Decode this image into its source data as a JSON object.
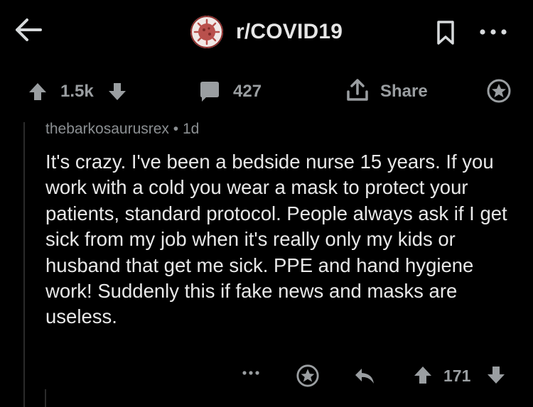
{
  "header": {
    "subreddit": "r/COVID19"
  },
  "post_actions": {
    "score": "1.5k",
    "comments": "427",
    "share_label": "Share"
  },
  "comment": {
    "author": "thebarkosaurusrex",
    "separator": "•",
    "age": "1d",
    "body": "It's crazy. I've been a bedside nurse 15 years. If you work with a cold you wear a mask to protect your patients, standard protocol. People always ask if I get sick from my job when it's really only my kids or husband that get me sick. PPE and hand hygiene work! Suddenly this if fake news and masks are useless.",
    "score": "171"
  },
  "colors": {
    "background": "#000000",
    "text": "#e8e8e8",
    "muted": "#9a9ea1"
  },
  "icons": [
    "back-arrow-icon",
    "subreddit-avatar-icon",
    "bookmark-icon",
    "more-options-icon",
    "upvote-icon",
    "downvote-icon",
    "comment-icon",
    "share-icon",
    "award-icon",
    "reply-icon"
  ]
}
